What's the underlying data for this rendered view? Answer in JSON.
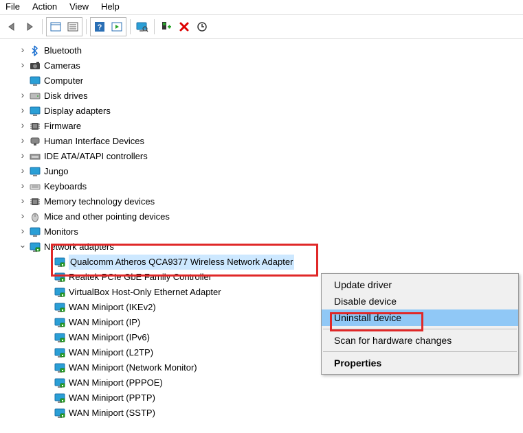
{
  "menu": {
    "file": "File",
    "action": "Action",
    "view": "View",
    "help": "Help"
  },
  "tree": {
    "items": [
      {
        "label": "Bluetooth",
        "icon": "bluetooth",
        "arrow": "closed",
        "indent": 1
      },
      {
        "label": "Cameras",
        "icon": "camera",
        "arrow": "closed",
        "indent": 1
      },
      {
        "label": "Computer",
        "icon": "monitor",
        "arrow": "none",
        "indent": 1
      },
      {
        "label": "Disk drives",
        "icon": "disk",
        "arrow": "closed",
        "indent": 1
      },
      {
        "label": "Display adapters",
        "icon": "monitor",
        "arrow": "closed",
        "indent": 1
      },
      {
        "label": "Firmware",
        "icon": "chip",
        "arrow": "closed",
        "indent": 1
      },
      {
        "label": "Human Interface Devices",
        "icon": "hid",
        "arrow": "closed",
        "indent": 1
      },
      {
        "label": "IDE ATA/ATAPI controllers",
        "icon": "ide",
        "arrow": "closed",
        "indent": 1
      },
      {
        "label": "Jungo",
        "icon": "monitor",
        "arrow": "closed",
        "indent": 1
      },
      {
        "label": "Keyboards",
        "icon": "keyboard",
        "arrow": "closed",
        "indent": 1
      },
      {
        "label": "Memory technology devices",
        "icon": "chip",
        "arrow": "closed",
        "indent": 1
      },
      {
        "label": "Mice and other pointing devices",
        "icon": "mouse",
        "arrow": "closed",
        "indent": 1
      },
      {
        "label": "Monitors",
        "icon": "monitor",
        "arrow": "closed",
        "indent": 1
      },
      {
        "label": "Network adapters",
        "icon": "net",
        "arrow": "open",
        "indent": 1
      },
      {
        "label": "Qualcomm Atheros QCA9377 Wireless Network Adapter",
        "icon": "net",
        "arrow": "none",
        "indent": 2,
        "selected": true
      },
      {
        "label": "Realtek PCIe GbE Family Controller",
        "icon": "net",
        "arrow": "none",
        "indent": 2
      },
      {
        "label": "VirtualBox Host-Only Ethernet Adapter",
        "icon": "net",
        "arrow": "none",
        "indent": 2
      },
      {
        "label": "WAN Miniport (IKEv2)",
        "icon": "net",
        "arrow": "none",
        "indent": 2
      },
      {
        "label": "WAN Miniport (IP)",
        "icon": "net",
        "arrow": "none",
        "indent": 2
      },
      {
        "label": "WAN Miniport (IPv6)",
        "icon": "net",
        "arrow": "none",
        "indent": 2
      },
      {
        "label": "WAN Miniport (L2TP)",
        "icon": "net",
        "arrow": "none",
        "indent": 2
      },
      {
        "label": "WAN Miniport (Network Monitor)",
        "icon": "net",
        "arrow": "none",
        "indent": 2
      },
      {
        "label": "WAN Miniport (PPPOE)",
        "icon": "net",
        "arrow": "none",
        "indent": 2
      },
      {
        "label": "WAN Miniport (PPTP)",
        "icon": "net",
        "arrow": "none",
        "indent": 2
      },
      {
        "label": "WAN Miniport (SSTP)",
        "icon": "net",
        "arrow": "none",
        "indent": 2
      }
    ]
  },
  "context_menu": {
    "update": "Update driver",
    "disable": "Disable device",
    "uninstall": "Uninstall device",
    "scan": "Scan for hardware changes",
    "properties": "Properties"
  }
}
